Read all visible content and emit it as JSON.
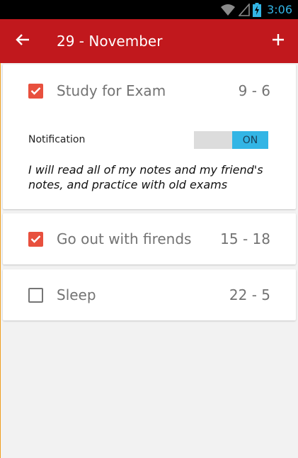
{
  "status_bar": {
    "time": "3:06",
    "icons": [
      "wifi-icon",
      "signal-icon",
      "battery-charging-icon"
    ],
    "time_color": "#33b5e5"
  },
  "app_bar": {
    "title": "29 - November",
    "back_icon": "arrow-left-icon",
    "add_icon": "plus-icon",
    "background": "#c1181d"
  },
  "tasks": [
    {
      "name": "Study for Exam",
      "time": "9 - 6",
      "checked": true,
      "expanded": true,
      "notification_label": "Notification",
      "notification_state": "ON",
      "description": "I will read all of my notes and my friend's notes, and practice with old exams"
    },
    {
      "name": "Go out with firends",
      "time": "15 - 18",
      "checked": true
    },
    {
      "name": "Sleep",
      "time": "22 - 5",
      "checked": false
    }
  ],
  "colors": {
    "checkbox_checked": "#e8503e",
    "toggle_on": "#33b5e5"
  }
}
